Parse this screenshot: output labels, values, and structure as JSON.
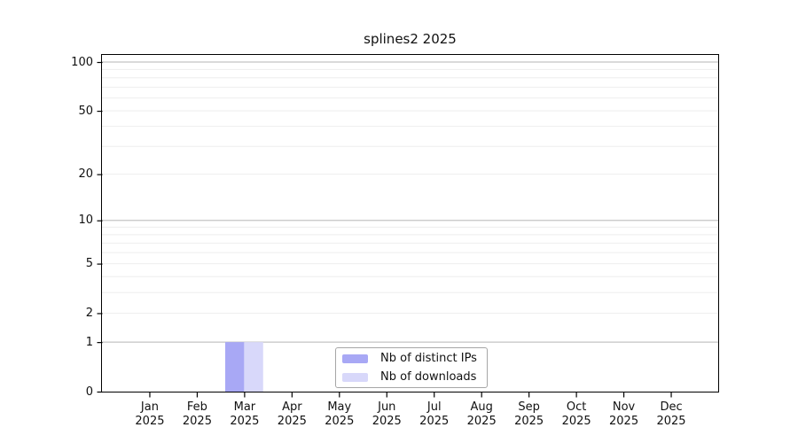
{
  "chart_data": {
    "type": "bar",
    "title": "splines2 2025",
    "x_categories": [
      "Jan",
      "Feb",
      "Mar",
      "Apr",
      "May",
      "Jun",
      "Jul",
      "Aug",
      "Sep",
      "Oct",
      "Nov",
      "Dec"
    ],
    "x_year": "2025",
    "series": [
      {
        "name": "Nb of distinct IPs",
        "color": "#a8a8f5",
        "values": [
          0,
          0,
          1,
          0,
          0,
          0,
          0,
          0,
          0,
          0,
          0,
          0
        ]
      },
      {
        "name": "Nb of downloads",
        "color": "#d8d8fa",
        "values": [
          0,
          0,
          1,
          0,
          0,
          0,
          0,
          0,
          0,
          0,
          0,
          0
        ]
      }
    ],
    "y_scale": "log1p",
    "y_ticks": [
      0,
      1,
      2,
      5,
      10,
      20,
      50,
      100
    ],
    "ylim_top_transformed": 4.7146,
    "grid": {
      "major_values": [
        1,
        10,
        100
      ],
      "minor_values": [
        2,
        3,
        4,
        5,
        6,
        7,
        8,
        9,
        20,
        30,
        40,
        50,
        60,
        70,
        80,
        90
      ],
      "major_color": "#c4c4c4",
      "minor_color": "#eeeeee"
    },
    "legend_position": "inside-bottom-center",
    "axis_color": "#000000",
    "background_color": "#ffffff"
  }
}
